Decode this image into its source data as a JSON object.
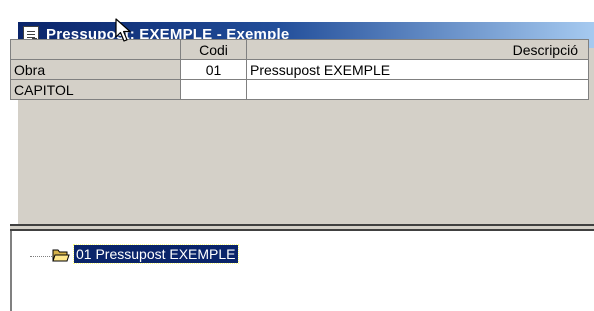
{
  "window": {
    "title": "Pressupost: EXEMPLE - Exemple"
  },
  "grid": {
    "columns": [
      "",
      "Codi",
      "Descripció"
    ],
    "rows": [
      {
        "label": "Obra",
        "codi": "01",
        "descripcio": "Pressupost EXEMPLE"
      },
      {
        "label": "CAPITOL",
        "codi": "",
        "descripcio": ""
      }
    ]
  },
  "tree": {
    "items": [
      {
        "label": "01 Pressupost EXEMPLE",
        "selected": true
      }
    ]
  },
  "icons": {
    "window": "document-icon",
    "tree_item": "folder-open-icon",
    "pointer": "mouse-pointer-icon"
  },
  "colors": {
    "titlebar_start": "#0a246a",
    "titlebar_end": "#a6caf0",
    "selection": "#0a246a",
    "window_bg": "#d4d0c8"
  }
}
